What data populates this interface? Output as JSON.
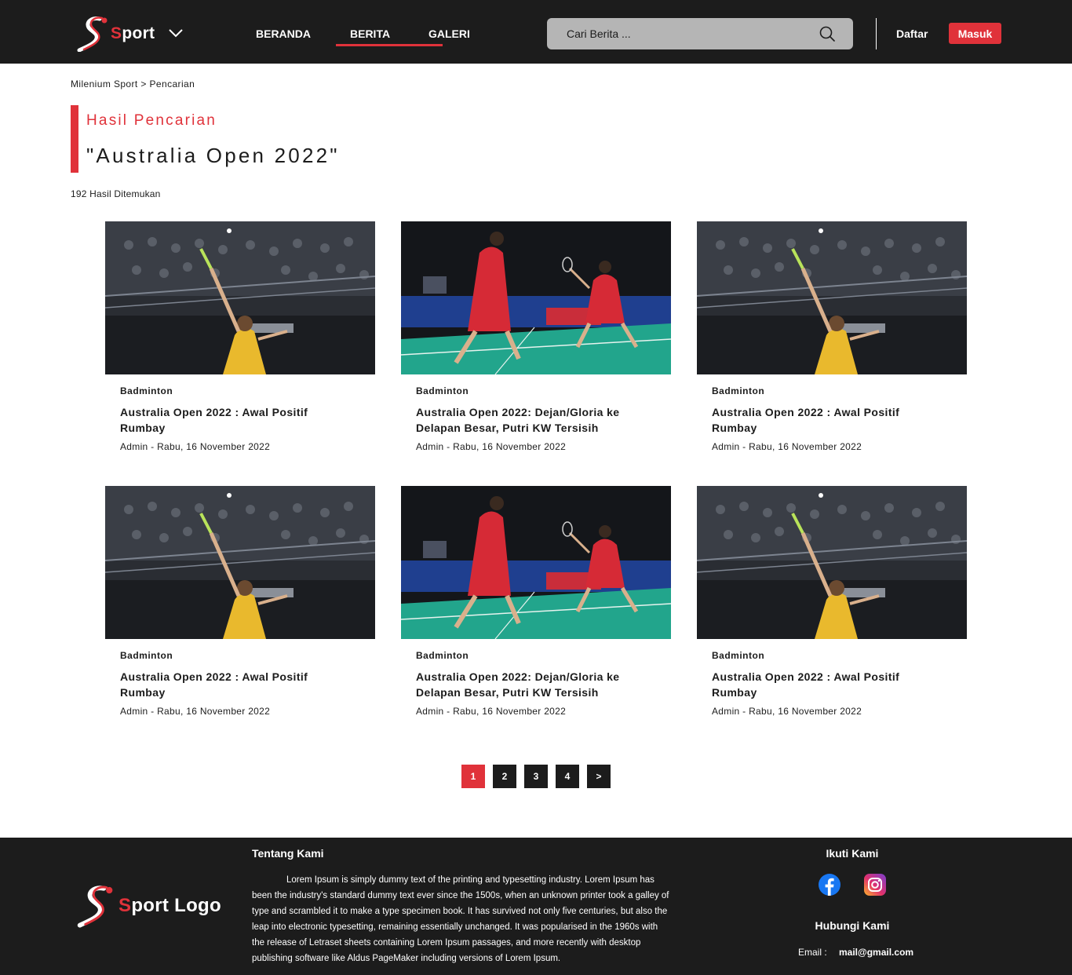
{
  "header": {
    "logo_text_first": "S",
    "logo_text_rest": "port",
    "nav": [
      {
        "label": "BERANDA",
        "active": false
      },
      {
        "label": "BERITA",
        "active": true
      },
      {
        "label": "GALERI",
        "active": false
      }
    ],
    "search_placeholder": "Cari Berita ...",
    "register_label": "Daftar",
    "login_label": "Masuk"
  },
  "breadcrumb": {
    "home": "Milenium Sport",
    "separator": ">",
    "current": "Pencarian"
  },
  "search_results": {
    "label": "Hasil Pencarian",
    "query": "\"Australia Open 2022\"",
    "count_text": "192 Hasil Ditemukan"
  },
  "cards": [
    {
      "category": "Badminton",
      "title": "Australia Open 2022 : Awal Positif Rumbay",
      "meta": "Admin - Rabu, 16 November 2022",
      "image": "badminton-single-player"
    },
    {
      "category": "Badminton",
      "title": "Australia Open 2022: Dejan/Gloria ke Delapan Besar, Putri KW Tersisih",
      "meta": "Admin - Rabu, 16 November 2022",
      "image": "badminton-mixed-doubles"
    },
    {
      "category": "Badminton",
      "title": "Australia Open 2022 : Awal Positif Rumbay",
      "meta": "Admin - Rabu, 16 November 2022",
      "image": "badminton-single-player"
    },
    {
      "category": "Badminton",
      "title": "Australia Open 2022 : Awal Positif Rumbay",
      "meta": "Admin - Rabu, 16 November 2022",
      "image": "badminton-single-player"
    },
    {
      "category": "Badminton",
      "title": "Australia Open 2022: Dejan/Gloria ke Delapan Besar, Putri KW Tersisih",
      "meta": "Admin - Rabu, 16 November 2022",
      "image": "badminton-mixed-doubles"
    },
    {
      "category": "Badminton",
      "title": "Australia Open 2022 : Awal Positif Rumbay",
      "meta": "Admin - Rabu, 16 November 2022",
      "image": "badminton-single-player"
    }
  ],
  "pagination": {
    "pages": [
      "1",
      "2",
      "3",
      "4"
    ],
    "current": "1",
    "next_label": ">"
  },
  "footer": {
    "logo_text_first": "S",
    "logo_text_rest": "port Logo",
    "about_title": "Tentang Kami",
    "about_text": "Lorem Ipsum is simply dummy text of the printing and typesetting industry. Lorem Ipsum has been the industry's standard dummy text ever since the 1500s, when an unknown printer took a galley of type and scrambled it to make a type specimen book. It has survived not only five centuries, but also the leap into electronic typesetting, remaining essentially unchanged. It was popularised in the 1960s with the release of Letraset sheets containing Lorem Ipsum passages, and more recently with desktop publishing software like Aldus PageMaker including versions of Lorem Ipsum.",
    "follow_title": "Ikuti Kami",
    "social": [
      "facebook-icon",
      "instagram-icon"
    ],
    "contact_title": "Hubungi Kami",
    "email_label": "Email :",
    "email_value": "mail@gmail.com"
  },
  "colors": {
    "dark": "#1c1c1c",
    "accent": "#e0323a",
    "search_bg": "#b5b5b5",
    "white": "#ffffff"
  }
}
